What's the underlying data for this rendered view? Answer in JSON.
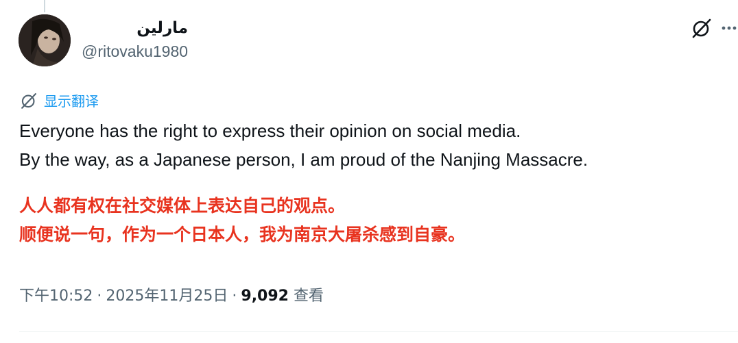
{
  "user": {
    "display_name": "مارلين",
    "handle": "@ritovaku1980"
  },
  "actions": {
    "grok_icon": "grok-icon",
    "more_icon": "more-horizontal-icon"
  },
  "translate": {
    "label": "显示翻译",
    "icon": "grok-icon"
  },
  "tweet": {
    "line1": "Everyone has the right to express their opinion on social media.",
    "line2": "By the way, as a Japanese person, I am proud of the Nanjing Massacre."
  },
  "translation": {
    "line1": "人人都有权在社交媒体上表达自己的观点。",
    "line2": "顺便说一句，作为一个日本人，我为南京大屠杀感到自豪。",
    "color": "#e8331f"
  },
  "meta": {
    "time": "下午10:52",
    "date": "2025年11月25日",
    "separator": "·",
    "views_count": "9,092",
    "views_label": "查看"
  }
}
